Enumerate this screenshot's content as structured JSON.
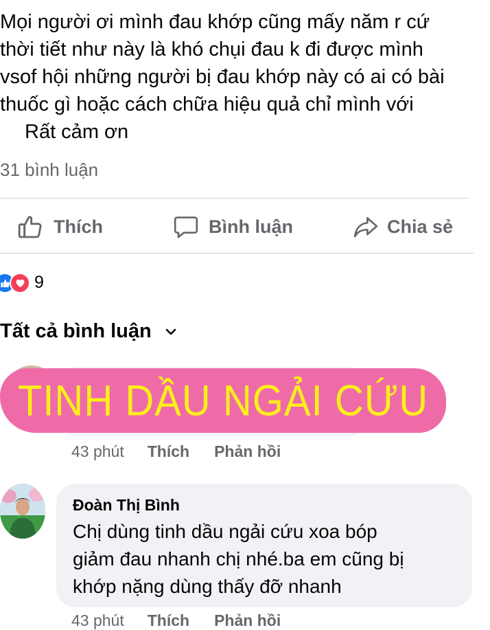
{
  "post": {
    "lines": [
      "Mọi người ơi mình đau khớp cũng mấy năm r cứ",
      "thời tiết như này là khó chụi đau k đi được mình",
      "vsof hội những người bị đau khớp này có ai có bài",
      "thuốc gì hoặc cách chữa hiệu quả chỉ mình với",
      "Rất cảm ơn"
    ],
    "comment_count": "31 bình luận"
  },
  "actions": {
    "like": {
      "label": "Thích",
      "icon": "thumbs-up-icon"
    },
    "comment": {
      "label": "Bình luận",
      "icon": "speech-bubble-icon"
    },
    "share": {
      "label": "Chia sẻ",
      "icon": "share-arrow-icon"
    }
  },
  "reactions": {
    "count": "9",
    "icons": [
      "like-reaction-icon",
      "love-reaction-icon"
    ]
  },
  "comments_filter": {
    "label": "Tất cả bình luận",
    "icon": "chevron-down-icon"
  },
  "overlay": {
    "text": "TINH DẦU NGẢI CỨU",
    "background": "#ef6ba8",
    "color": "#ffef1a"
  },
  "comments": [
    {
      "time": "43 phút",
      "like_label": "Thích",
      "reply_label": "Phản hồi"
    },
    {
      "author": "Đoàn Thị Bình",
      "lines": [
        "Chị dùng tinh dầu ngải cứu xoa bóp",
        "giảm đau nhanh chị nhé.ba em cũng bị",
        "khớp nặng dùng thấy đỡ nhanh"
      ],
      "time": "43 phút",
      "like_label": "Thích",
      "reply_label": "Phản hồi"
    }
  ],
  "colors": {
    "secondary_text": "#65676b",
    "bubble": "#f0f2f5",
    "divider": "#ced0d4",
    "like_blue": "#1877f2",
    "love_red": "#f33e58"
  }
}
